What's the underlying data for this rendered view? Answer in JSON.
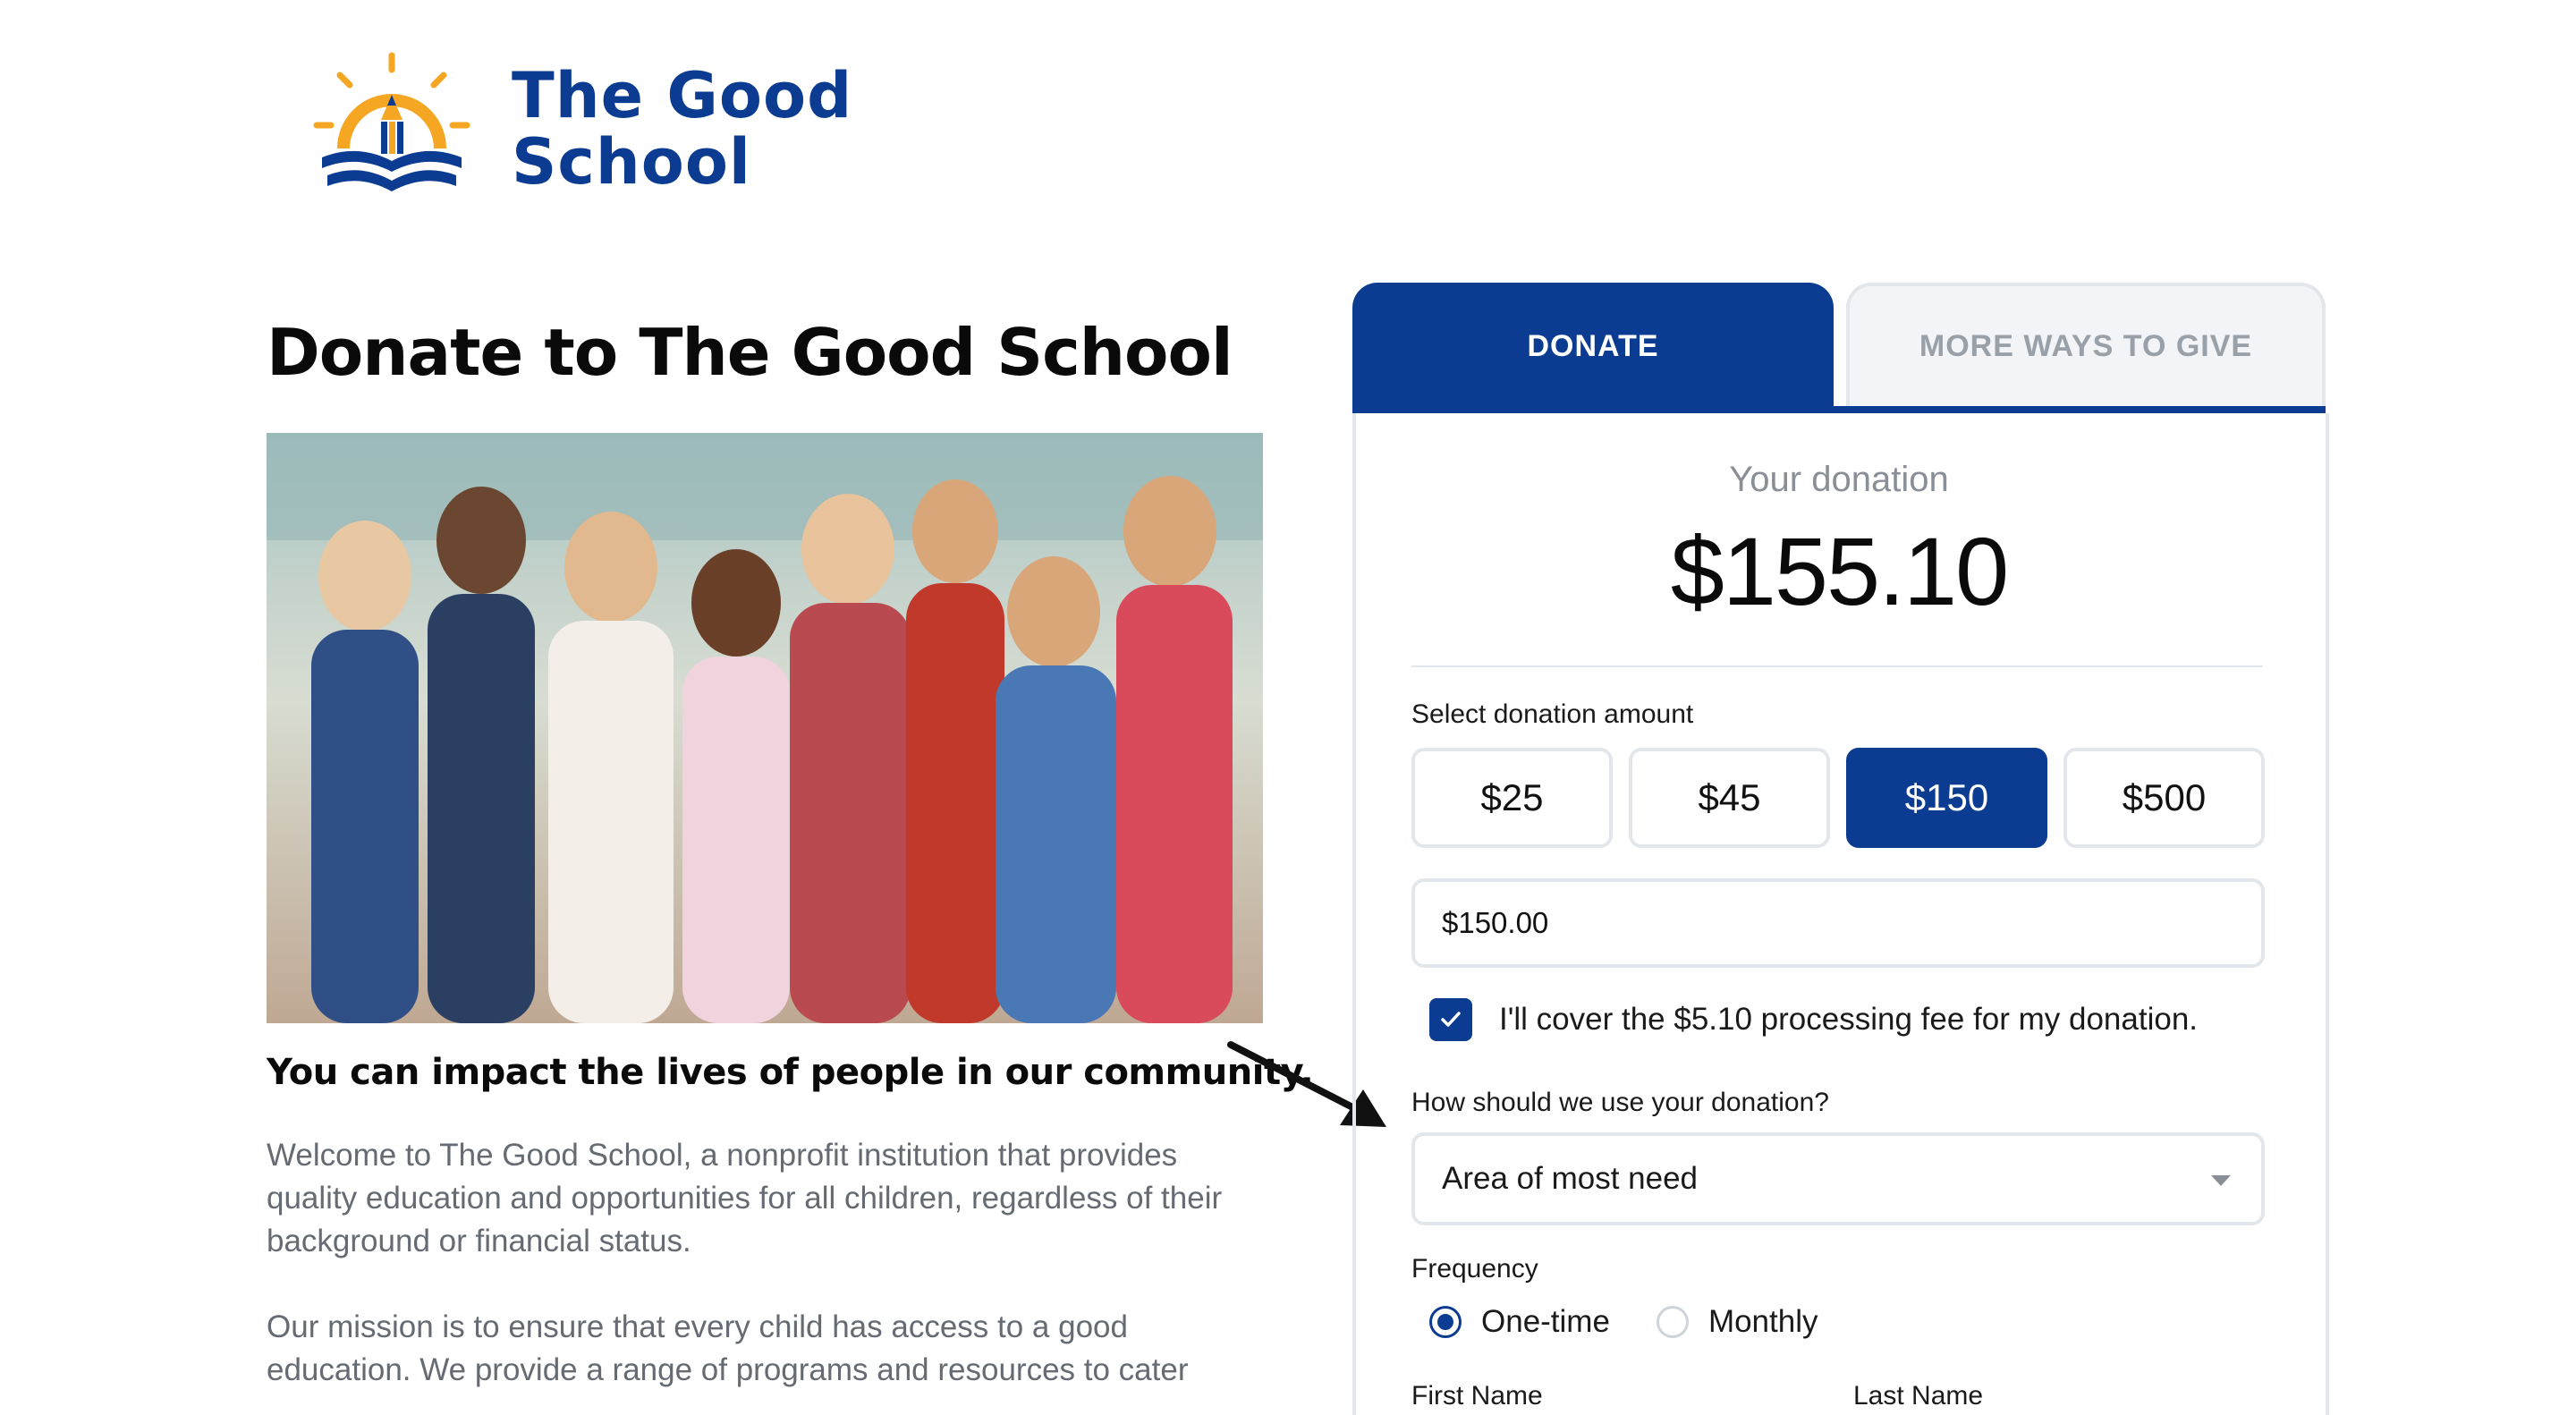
{
  "brand": {
    "name_line1": "The Good",
    "name_line2": "School",
    "primary_color": "#0b3c91",
    "accent_color": "#f5a623"
  },
  "left": {
    "title": "Donate to The Good School",
    "subheading": "You can impact the lives of people in our community.",
    "paragraph1": "Welcome to The Good School, a nonprofit institution that provides quality education and opportunities for all children, regardless of their background or financial status.",
    "paragraph2": "Our mission is to ensure that every child has access to a good education. We provide a range of programs and resources to cater"
  },
  "tabs": {
    "donate": "DONATE",
    "more_ways": "MORE WAYS TO GIVE"
  },
  "donation": {
    "label": "Your donation",
    "total": "$155.10",
    "select_label": "Select donation amount",
    "amounts": [
      "$25",
      "$45",
      "$150",
      "$500"
    ],
    "selected_amount": "$150",
    "amount_input_value": "$150.00",
    "fee_checkbox_checked": true,
    "fee_text": "I'll cover the $5.10 processing fee for my donation.",
    "use_label": "How should we use your donation?",
    "use_selected": "Area of most need",
    "frequency_label": "Frequency",
    "frequency_options": [
      "One-time",
      "Monthly"
    ],
    "frequency_selected": "One-time",
    "first_name_label": "First Name",
    "last_name_label": "Last Name"
  }
}
